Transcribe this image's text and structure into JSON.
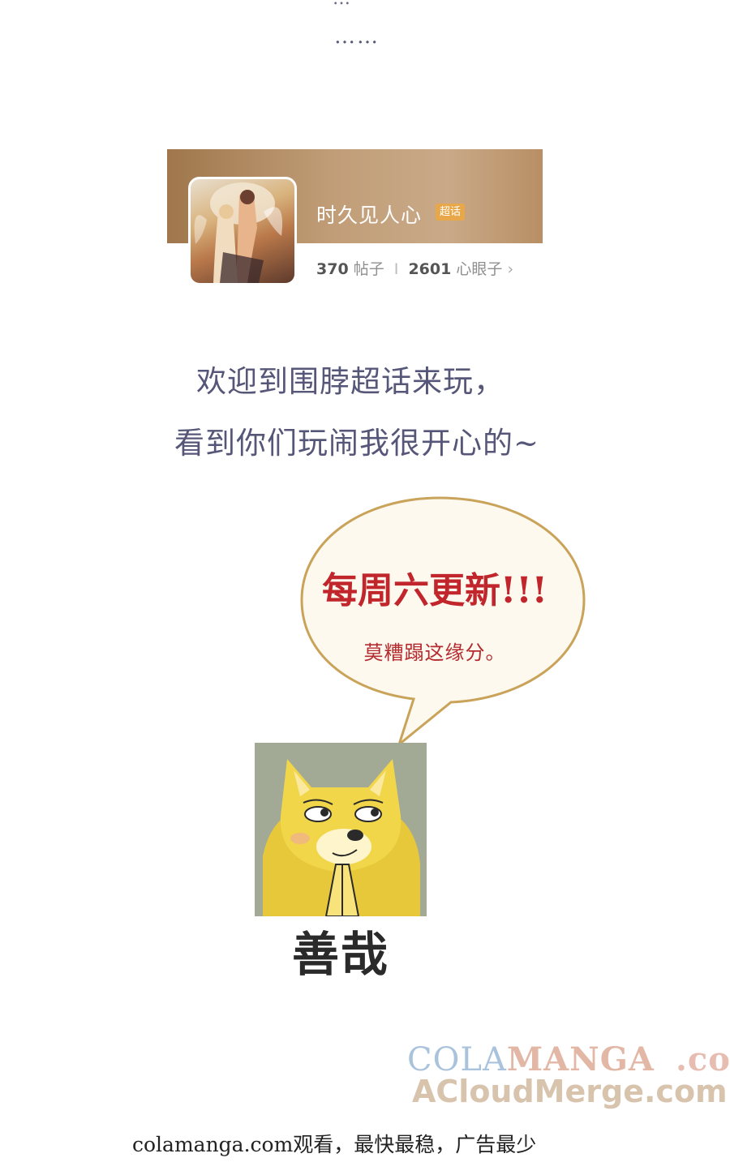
{
  "top": {
    "cut_text": "…",
    "dots": "……"
  },
  "card": {
    "topic_name": "时久见人心",
    "badge": "超话",
    "posts_count": "370",
    "posts_label": "帖子",
    "separator": "I",
    "members_count": "2601",
    "members_label": "心眼子",
    "chevron": "›"
  },
  "welcome": {
    "line1": "欢迎到围脖超话来玩，",
    "line2": "看到你们玩闹我很开心的~"
  },
  "bubble": {
    "main": "每周六更新!!!",
    "sub": "莫糟蹋这缘分。"
  },
  "meme": {
    "caption": "善哉"
  },
  "watermark": {
    "part1": "COLA",
    "part2": "MANGA",
    "part3": ".com",
    "line2": "ACloudMerge.com"
  },
  "footer": {
    "text": "colamanga.com观看，最快最稳，广告最少"
  },
  "colors": {
    "banner": "#b8905f",
    "badge": "#e8a84a",
    "welcome_text": "#565678",
    "bubble_text": "#c0262b",
    "bubble_fill": "#fdf9ef",
    "bubble_stroke": "#c9a35a"
  }
}
